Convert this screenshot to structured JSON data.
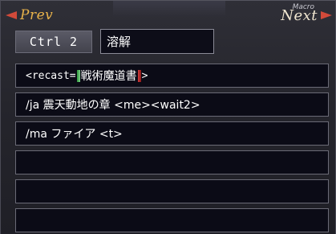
{
  "nav": {
    "prev_label": "Prev",
    "next_label": "Next",
    "macro_label": "Macro"
  },
  "macro": {
    "ctrl_label": "Ctrl 2",
    "name": "溶解"
  },
  "lines": [
    {
      "pre": "<recast=",
      "term": "戦術魔道書",
      "post": ">"
    },
    {
      "text": "/ja 震天動地の章 <me><wait2>"
    },
    {
      "text": "/ma ファイア <t>"
    },
    {
      "text": ""
    },
    {
      "text": ""
    },
    {
      "text": ""
    }
  ],
  "colors": {
    "prev": "#e8b24a",
    "next": "#f0e6d0",
    "arrow": "#d24a3a",
    "autotranslate_open": "#2e9a3c",
    "autotranslate_close": "#d23a3a"
  }
}
